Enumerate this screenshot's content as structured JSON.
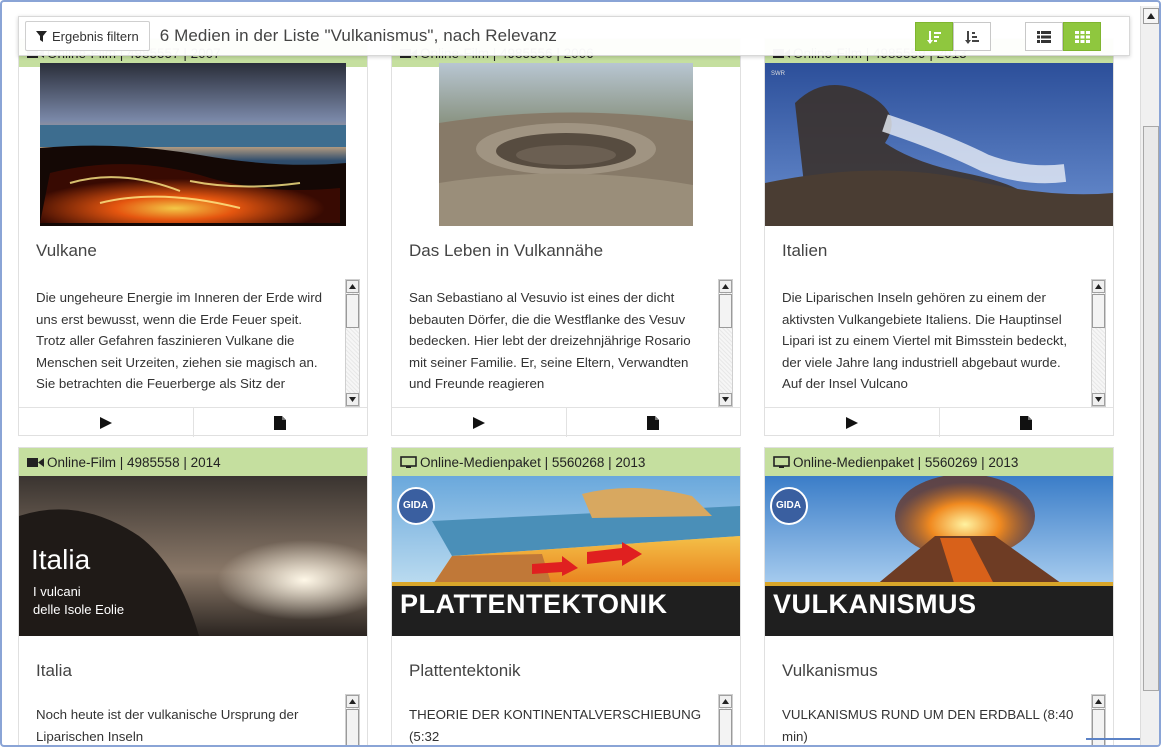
{
  "toolbar": {
    "filter_label": "Ergebnis filtern",
    "result_title": "6 Medien in der Liste \"Vulkanismus\", nach Relevanz"
  },
  "colors": {
    "accent": "#8fc73e",
    "meta_bar": "#c5df9f",
    "frame_border": "#8aa4d6"
  },
  "cards": [
    {
      "meta": "Online-Film | 4985557 | 2007",
      "type_icon": "film-icon",
      "title": "Vulkane",
      "thumb": "lava-flow-image",
      "description": "Die ungeheure Energie im Inneren der Erde wird uns erst bewusst, wenn die Erde Feuer speit. Trotz aller Gefahren faszinieren Vulkane die Menschen seit Urzeiten, ziehen sie magisch an. Sie betrachten die Feuerberge als Sitz der"
    },
    {
      "meta": "Online-Film | 4985556 | 2006",
      "type_icon": "film-icon",
      "title": "Das Leben in Vulkannähe",
      "thumb": "crater-aerial-image",
      "description": "San Sebastiano al Vesuvio ist eines der dicht bebauten Dörfer, die die Westflanke des Vesuv bedecken. Hier lebt der dreizehnjährige Rosario mit seiner Familie. Er, seine Eltern, Verwandten und Freunde reagieren"
    },
    {
      "meta": "Online-Film | 4985559 | 2013",
      "type_icon": "film-icon",
      "title": "Italien",
      "thumb": "smoking-volcano-image",
      "description": "Die Liparischen Inseln gehören zu einem der aktivsten Vulkangebiete Italiens. Die Hauptinsel Lipari ist zu einem Viertel mit Bimsstein bedeckt, der viele Jahre lang industriell abgebaut wurde. Auf der Insel Vulcano"
    },
    {
      "meta": "Online-Film | 4985558 | 2014",
      "type_icon": "film-icon",
      "title": "Italia",
      "thumb": "italia-cover-image",
      "thumb_text": {
        "big": "Italia",
        "line1": "I vulcani",
        "line2": "delle Isole Eolie"
      },
      "description": "Noch heute ist der vulkanische Ursprung der Liparischen Inseln"
    },
    {
      "meta": "Online-Medienpaket | 5560268 | 2013",
      "type_icon": "monitor-icon",
      "title": "Plattentektonik",
      "thumb": "plate-tectonics-cover-image",
      "thumb_text": {
        "logo": "GIDA",
        "banner": "PLATTENTEKTONIK"
      },
      "description": "THEORIE DER KONTINENTALVERSCHIEBUNG (5:32"
    },
    {
      "meta": "Online-Medienpaket | 5560269 | 2013",
      "type_icon": "monitor-icon",
      "title": "Vulkanismus",
      "thumb": "volcano-eruption-cover-image",
      "thumb_text": {
        "logo": "GIDA",
        "banner": "VULKANISMUS"
      },
      "description": "VULKANISMUS RUND UM DEN ERDBALL (8:40 min)"
    }
  ]
}
